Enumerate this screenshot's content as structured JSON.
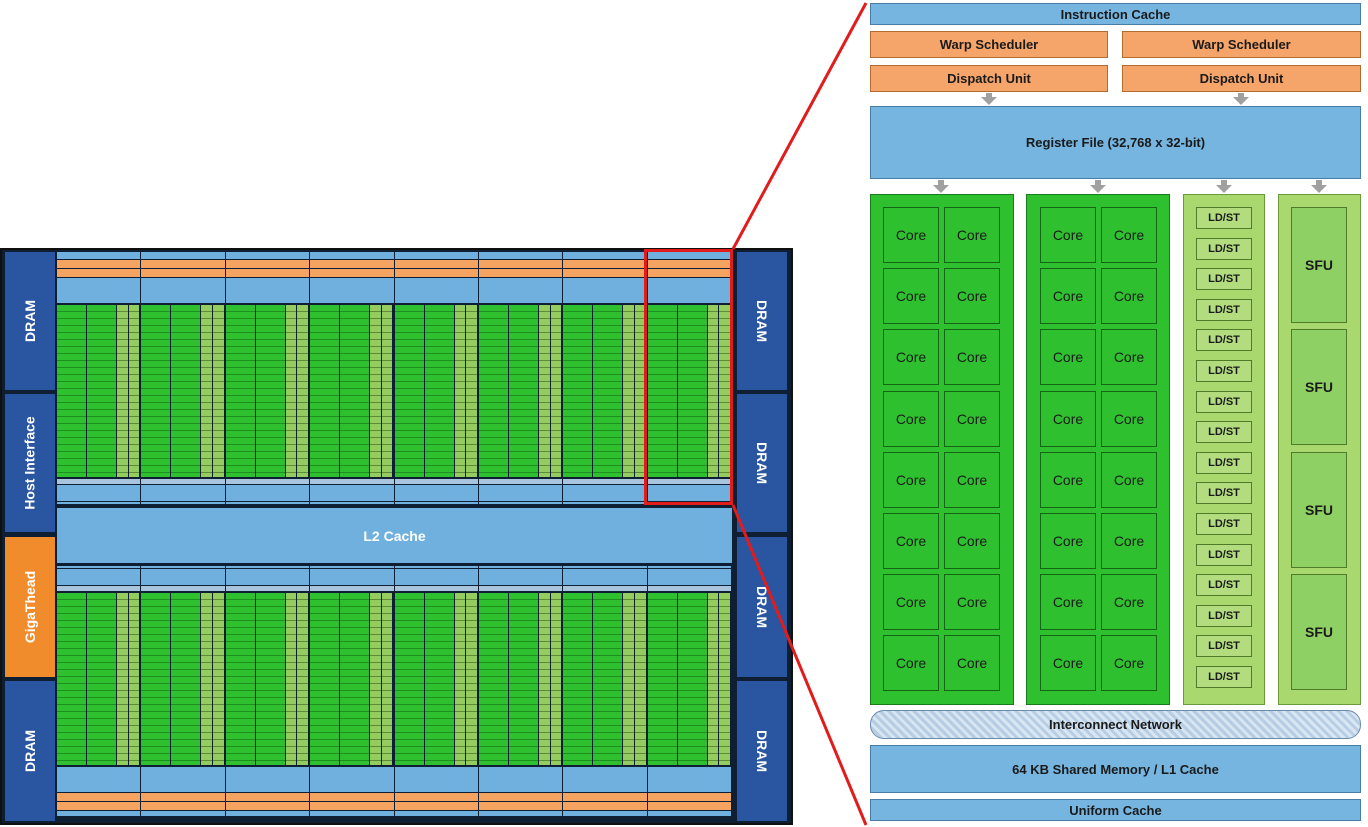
{
  "chip": {
    "left_blocks": [
      "DRAM",
      "Host Interface",
      "GigaThead",
      "DRAM"
    ],
    "right_blocks": [
      "DRAM",
      "DRAM",
      "DRAM",
      "DRAM"
    ],
    "l2_label": "L2 Cache",
    "sm_count_per_row": 8
  },
  "sm": {
    "instruction_cache": "Instruction Cache",
    "warp_schedulers": [
      "Warp Scheduler",
      "Warp Scheduler"
    ],
    "dispatch_units": [
      "Dispatch Unit",
      "Dispatch Unit"
    ],
    "register_file": "Register File (32,768 x 32-bit)",
    "core_label": "Core",
    "ldst_label": "LD/ST",
    "sfu_label": "SFU",
    "interconnect": "Interconnect Network",
    "shared_memory": "64 KB Shared Memory / L1 Cache",
    "uniform_cache": "Uniform Cache"
  },
  "colors": {
    "core_green": "#2ec02e",
    "ldst_green": "#a8d86e",
    "scheduler_orange": "#f5a46a",
    "cache_blue": "#75b5e0",
    "dram_blue": "#2a55a0",
    "gigathread_orange": "#f08c2c",
    "highlight_red": "#e21b1b"
  }
}
